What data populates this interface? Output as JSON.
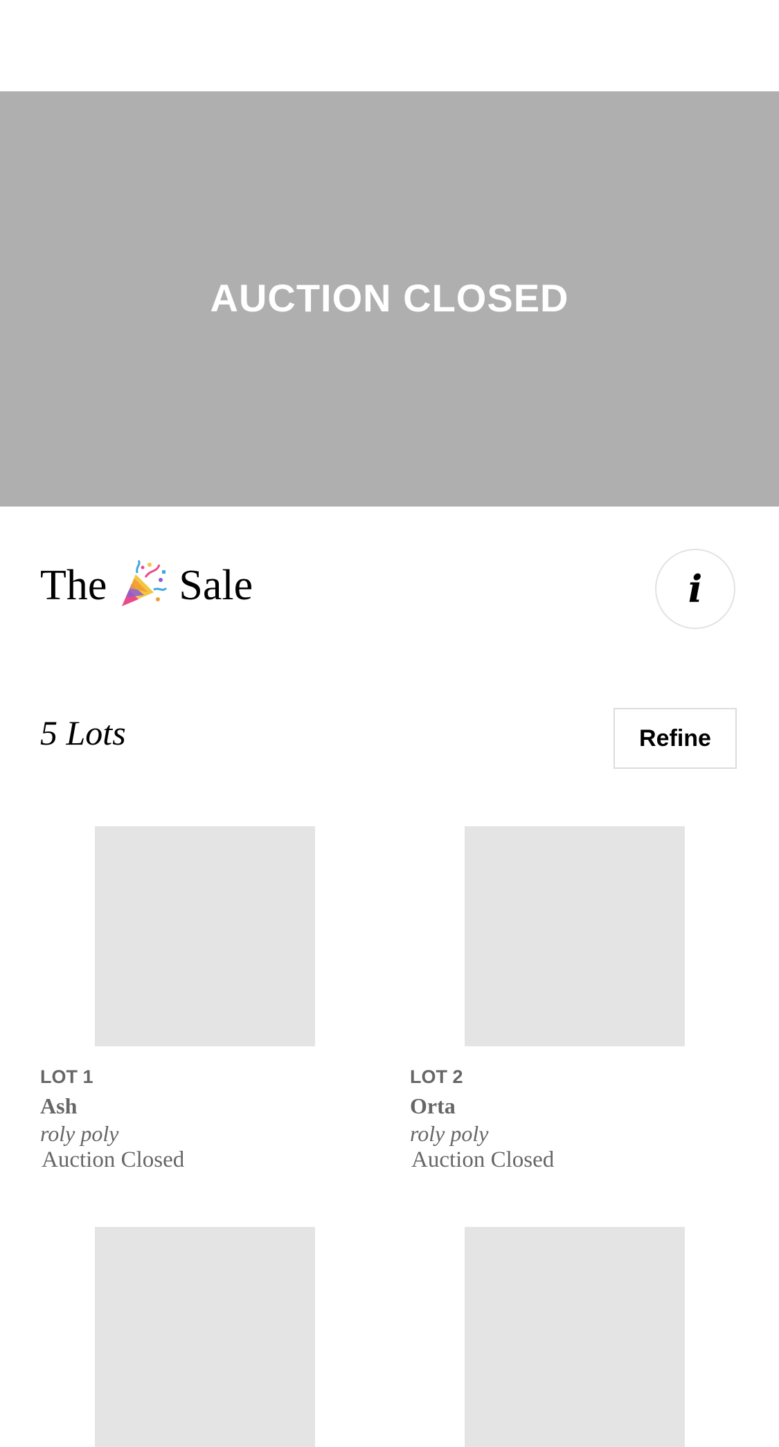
{
  "hero": {
    "status_text": "AUCTION CLOSED"
  },
  "sale": {
    "title_prefix": "The",
    "title_icon": "party-popper-icon",
    "title_suffix": "Sale",
    "info_icon": "info-icon",
    "info_symbol": "i"
  },
  "lots_header": {
    "count_label": "5 Lots",
    "refine_label": "Refine"
  },
  "lots": [
    {
      "lot_number": "LOT 1",
      "artist": "Ash",
      "title": "roly poly",
      "status": "Auction Closed"
    },
    {
      "lot_number": "LOT 2",
      "artist": "Orta",
      "title": "roly poly",
      "status": "Auction Closed"
    }
  ],
  "colors": {
    "hero_background": "#afafaf",
    "image_placeholder": "#e4e4e4",
    "muted_text": "#666666"
  }
}
